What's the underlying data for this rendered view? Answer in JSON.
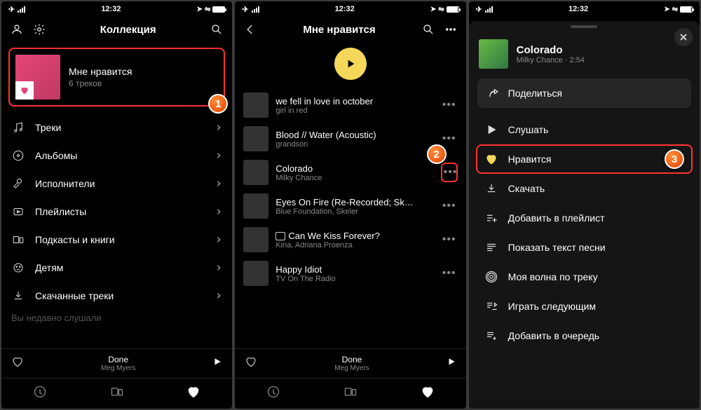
{
  "status": {
    "time": "12:32"
  },
  "screen1": {
    "title": "Коллекция",
    "liked_title": "Мне нравится",
    "liked_sub": "6 треков",
    "menu": [
      {
        "label": "Треки"
      },
      {
        "label": "Альбомы"
      },
      {
        "label": "Исполнители"
      },
      {
        "label": "Плейлисты"
      },
      {
        "label": "Подкасты и книги"
      },
      {
        "label": "Детям"
      },
      {
        "label": "Скачанные треки"
      }
    ],
    "recent_header": "Вы недавно слушали",
    "badge": "1"
  },
  "screen2": {
    "title": "Мне нравится",
    "tracks": [
      {
        "title": "we fell in love in october",
        "artist": "girl in red"
      },
      {
        "title": "Blood // Water (Acoustic)",
        "artist": "grandson"
      },
      {
        "title": "Colorado",
        "artist": "Milky Chance"
      },
      {
        "title": "Eyes On Fire (Re-Recorded; Sk…",
        "artist": "Blue Foundation, Skeler"
      },
      {
        "title": "Can We Kiss Forever?",
        "artist": "Kina, Adriana Proenza",
        "hq": true
      },
      {
        "title": "Happy Idiot",
        "artist": "TV On The Radio"
      }
    ],
    "badge": "2"
  },
  "now_playing": {
    "title": "Done",
    "artist": "Meg Myers"
  },
  "screen3": {
    "track_title": "Colorado",
    "track_sub": "Milky Chance · 2:54",
    "share": "Поделиться",
    "items": [
      {
        "label": "Слушать"
      },
      {
        "label": "Нравится"
      },
      {
        "label": "Скачать"
      },
      {
        "label": "Добавить в плейлист"
      },
      {
        "label": "Показать текст песни"
      },
      {
        "label": "Моя волна по треку"
      },
      {
        "label": "Играть следующим"
      },
      {
        "label": "Добавить в очередь"
      }
    ],
    "badge": "3"
  }
}
